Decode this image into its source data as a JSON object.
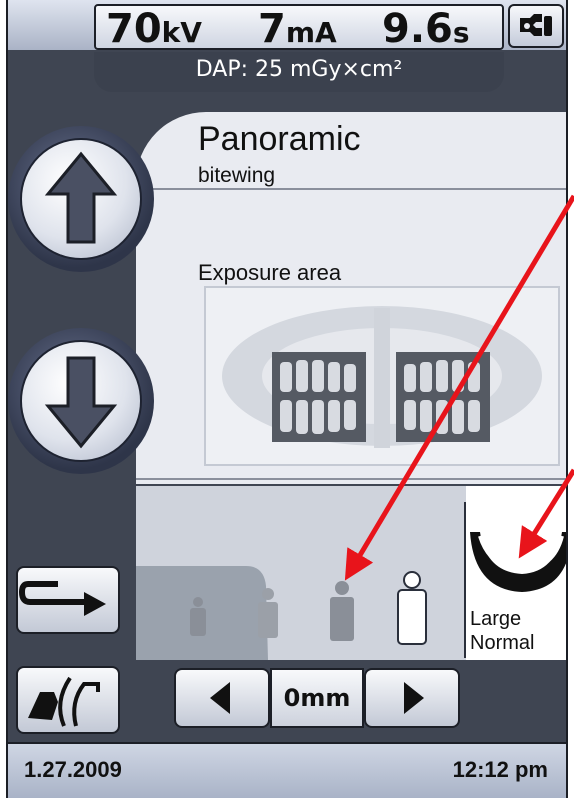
{
  "exposure": {
    "kv_value": "70",
    "kv_unit": "kV",
    "ma_value": "7",
    "ma_unit": "mA",
    "time_value": "9.6",
    "time_unit": "s",
    "dap": "DAP: 25 mGy×cm²"
  },
  "program": {
    "title": "Panoramic",
    "subtitle": "bitewing",
    "exposure_area_label": "Exposure area"
  },
  "patient": {
    "jaw_size_line1": "Large",
    "jaw_size_line2": "Normal",
    "size_levels": 4,
    "selected_level": 4
  },
  "stepper": {
    "value": "0mm"
  },
  "status": {
    "date": "1.27.2009",
    "time": "12:12 pm"
  },
  "icons": {
    "tool": "wrench-icon",
    "up": "arrow-up-icon",
    "down": "arrow-down-icon",
    "return": "return-arrow-icon",
    "patient": "patient-positioning-icon",
    "left": "triangle-left-icon",
    "right": "triangle-right-icon"
  },
  "colors": {
    "screen_bg": "#3f4552",
    "panel_bg": "#e9ebf1",
    "annotation": "#e8141b"
  }
}
